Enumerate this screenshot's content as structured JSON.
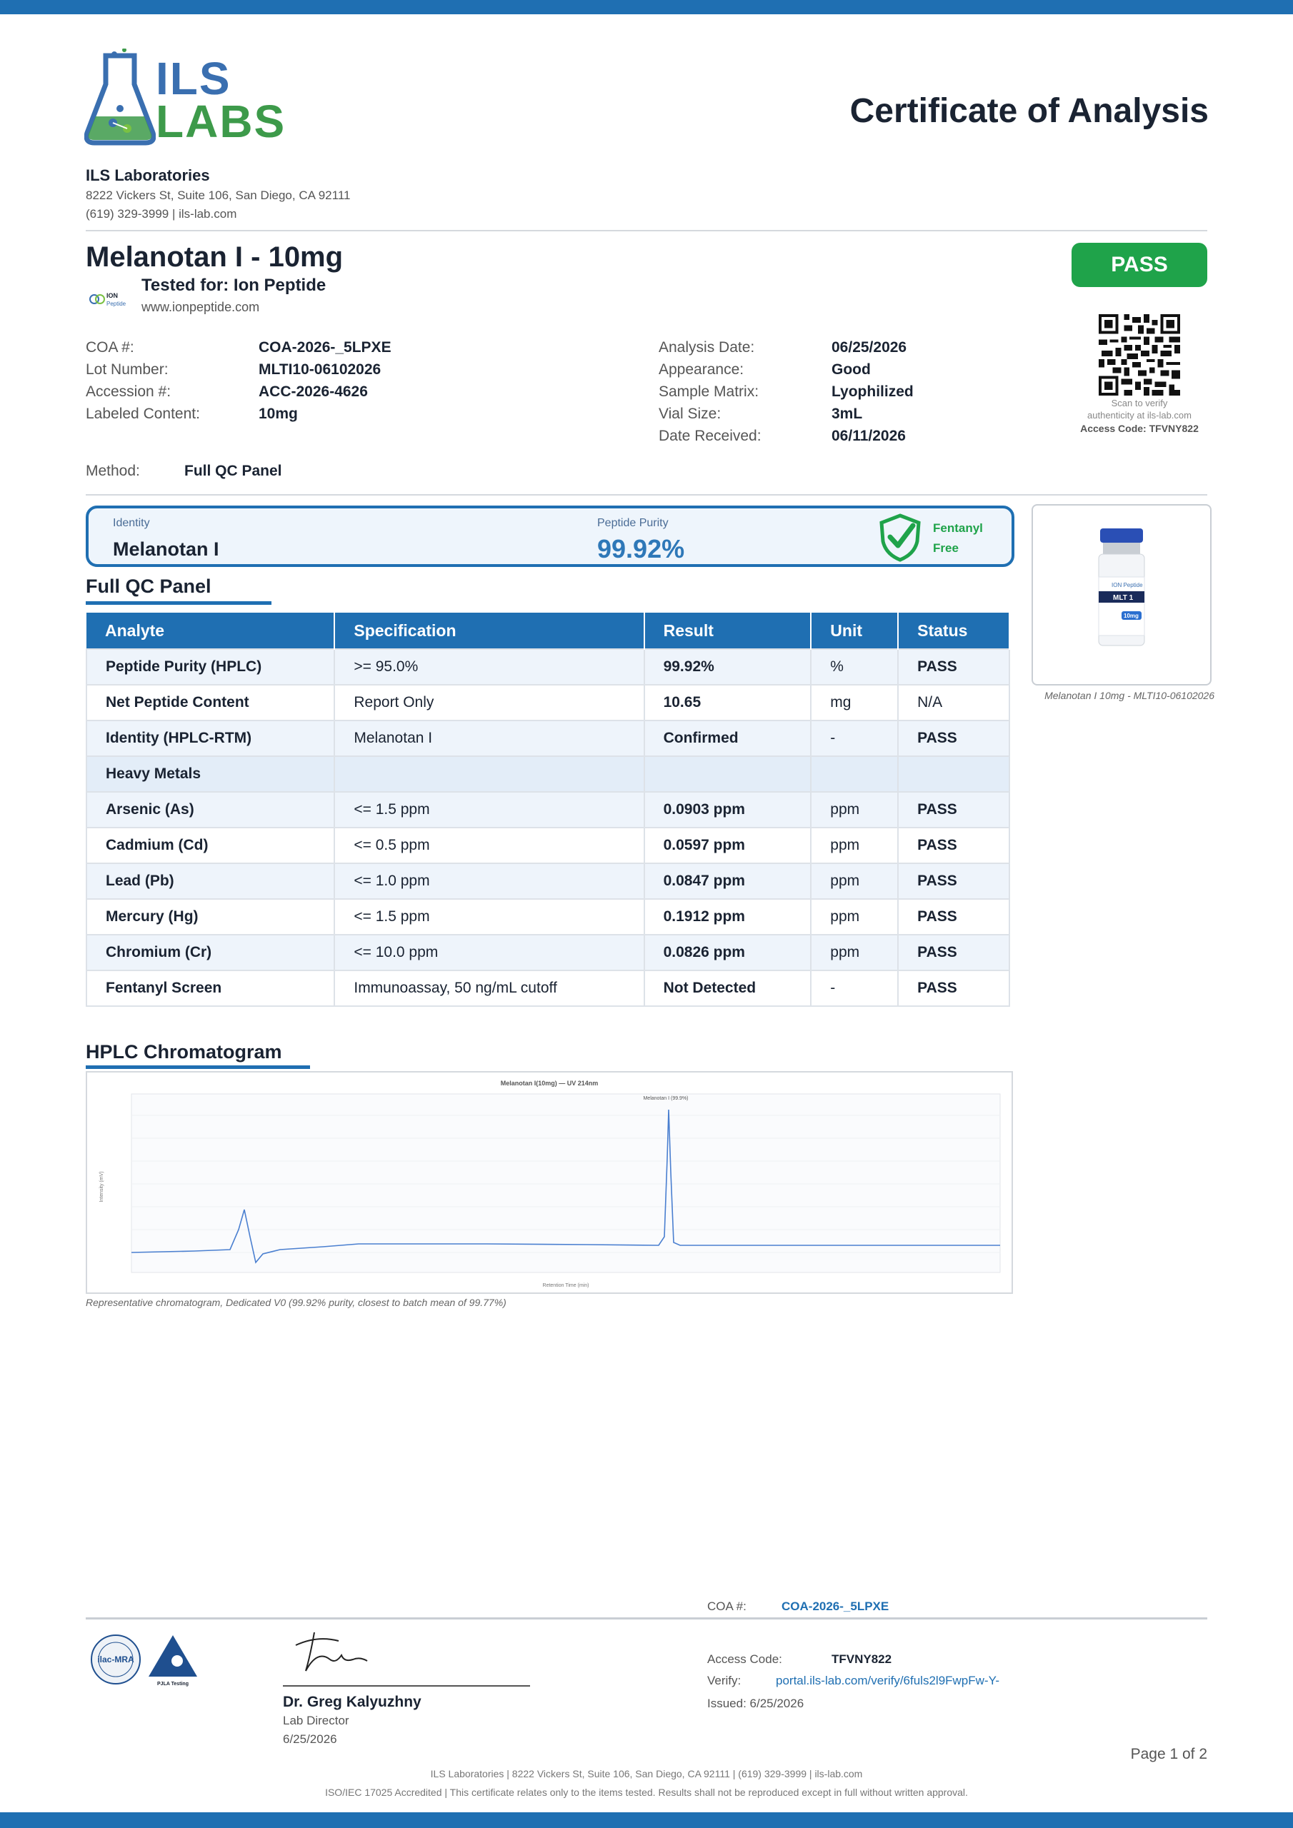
{
  "logo": {
    "top": "ILS",
    "bottom": "LABS"
  },
  "title": "Certificate of Analysis",
  "lab": {
    "name": "ILS Laboratories",
    "address": "8222 Vickers St, Suite 106, San Diego, CA 92111",
    "contact": "(619) 329-3999  |  ils-lab.com"
  },
  "product": {
    "name": "Melanotan I - 10mg",
    "tested_for": "Tested for: Ion Peptide",
    "client_url": "www.ionpeptide.com",
    "client_logo_text": "ION Peptide"
  },
  "result_badge": "PASS",
  "qr": {
    "note_line1": "Scan to verify",
    "note_line2": "authenticity at ils-lab.com",
    "access": "Access Code: TFVNY822"
  },
  "meta_left": [
    {
      "label": "COA #:",
      "value": "COA-2026-_5LPXE"
    },
    {
      "label": "Lot Number:",
      "value": "MLTI10-06102026"
    },
    {
      "label": "Accession #:",
      "value": "ACC-2026-4626"
    },
    {
      "label": "Labeled Content:",
      "value": "10mg"
    }
  ],
  "meta_right": [
    {
      "label": "Analysis Date:",
      "value": "06/25/2026"
    },
    {
      "label": "Appearance:",
      "value": "Good"
    },
    {
      "label": "Sample Matrix:",
      "value": "Lyophilized"
    },
    {
      "label": "Vial Size:",
      "value": "3mL"
    },
    {
      "label": "Date Received:",
      "value": "06/11/2026"
    }
  ],
  "method": {
    "label": "Method:",
    "value": "Full QC Panel"
  },
  "summary": {
    "identity_label": "Identity",
    "identity_value": "Melanotan I",
    "purity_label": "Peptide Purity",
    "purity_value": "99.92%",
    "fentanyl_line1": "Fentanyl",
    "fentanyl_line2": "Free"
  },
  "vial": {
    "brand": "ION Peptide",
    "label": "MLT 1",
    "dose": "10mg",
    "caption": "Melanotan I 10mg - MLTI10-06102026"
  },
  "qc_panel": {
    "title": "Full QC Panel",
    "headers": [
      "Analyte",
      "Specification",
      "Result",
      "Unit",
      "Status"
    ],
    "rows": [
      {
        "analyte": "Peptide Purity (HPLC)",
        "spec": ">= 95.0%",
        "result": "99.92%",
        "unit": "%",
        "status": "PASS"
      },
      {
        "analyte": "Net Peptide Content",
        "spec": "Report Only",
        "result": "10.65",
        "unit": "mg",
        "status": "N/A"
      },
      {
        "analyte": "Identity (HPLC-RTM)",
        "spec": "Melanotan I",
        "result": "Confirmed",
        "unit": "-",
        "status": "PASS"
      },
      {
        "analyte": "Heavy Metals",
        "spec": "",
        "result": "",
        "unit": "",
        "status": ""
      },
      {
        "analyte": "Arsenic (As)",
        "spec": "<= 1.5 ppm",
        "result": "0.0903 ppm",
        "unit": "ppm",
        "status": "PASS"
      },
      {
        "analyte": "Cadmium (Cd)",
        "spec": "<= 0.5 ppm",
        "result": "0.0597 ppm",
        "unit": "ppm",
        "status": "PASS"
      },
      {
        "analyte": "Lead (Pb)",
        "spec": "<= 1.0 ppm",
        "result": "0.0847 ppm",
        "unit": "ppm",
        "status": "PASS"
      },
      {
        "analyte": "Mercury (Hg)",
        "spec": "<= 1.5 ppm",
        "result": "0.1912 ppm",
        "unit": "ppm",
        "status": "PASS"
      },
      {
        "analyte": "Chromium (Cr)",
        "spec": "<= 10.0 ppm",
        "result": "0.0826 ppm",
        "unit": "ppm",
        "status": "PASS"
      },
      {
        "analyte": "Fentanyl Screen",
        "spec": "Immunoassay, 50 ng/mL cutoff",
        "result": "Not Detected",
        "unit": "-",
        "status": "PASS"
      }
    ]
  },
  "chromatogram": {
    "section_title": "HPLC Chromatogram",
    "plot_title": "Melanotan I(10mg) — UV 214nm",
    "peak_label": "Melanotan I (99.9%)",
    "caption": "Representative chromatogram, Dedicated V0 (99.92% purity, closest to batch mean of 99.77%)",
    "xlabel": "Retention Time (min)",
    "ylabel": "Intensity (mV)",
    "line_color": "#4a7fd0"
  },
  "footer": {
    "signer_name": "Dr. Greg Kalyuzhny",
    "signer_title": "Lab Director",
    "signer_date": "6/25/2026",
    "coa_label": "COA #:",
    "coa_value": "COA-2026-_5LPXE",
    "access_label": "Access Code:",
    "access_value": "TFVNY822",
    "verify_label": "Verify:",
    "verify_value": "portal.ils-lab.com/verify/6fuls2l9FwpFw-Y-",
    "issued": "Issued: 6/25/2026",
    "page": "Page 1 of 2",
    "line1": "ILS Laboratories  |  8222 Vickers St, Suite 106, San Diego, CA 92111  |  (619) 329-3999  |  ils-lab.com",
    "line2": "ISO/IEC 17025 Accredited  |  This certificate relates only to the items tested. Results shall not be reproduced except in full without written approval.",
    "ilac_text": "ilac-MRA",
    "pjla_text": "PJLA Testing"
  },
  "colors": {
    "brand_blue": "#1f6fb2",
    "pass_green": "#1fa34a"
  }
}
